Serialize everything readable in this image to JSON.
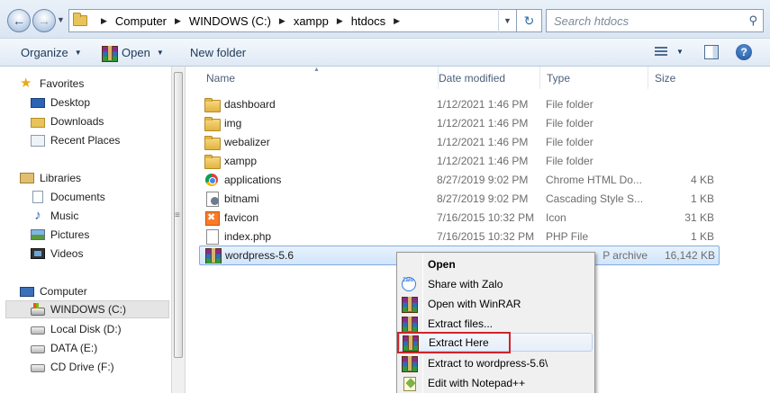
{
  "address": {
    "crumbs": [
      "Computer",
      "WINDOWS (C:)",
      "xampp",
      "htdocs"
    ],
    "search_placeholder": "Search htdocs"
  },
  "toolbar": {
    "organize": "Organize",
    "open": "Open",
    "new_folder": "New folder"
  },
  "nav": {
    "favorites": "Favorites",
    "favorites_items": [
      "Desktop",
      "Downloads",
      "Recent Places"
    ],
    "libraries": "Libraries",
    "library_items": [
      "Documents",
      "Music",
      "Pictures",
      "Videos"
    ],
    "computer": "Computer",
    "computer_items": [
      "WINDOWS (C:)",
      "Local Disk (D:)",
      "DATA (E:)",
      "CD Drive (F:)"
    ],
    "selected": "WINDOWS (C:)"
  },
  "columns": {
    "name": "Name",
    "date": "Date modified",
    "type": "Type",
    "size": "Size"
  },
  "files": [
    {
      "name": "dashboard",
      "date": "1/12/2021 1:46 PM",
      "type": "File folder",
      "size": "",
      "icon": "folder-icon"
    },
    {
      "name": "img",
      "date": "1/12/2021 1:46 PM",
      "type": "File folder",
      "size": "",
      "icon": "folder-icon"
    },
    {
      "name": "webalizer",
      "date": "1/12/2021 1:46 PM",
      "type": "File folder",
      "size": "",
      "icon": "folder-icon"
    },
    {
      "name": "xampp",
      "date": "1/12/2021 1:46 PM",
      "type": "File folder",
      "size": "",
      "icon": "folder-icon"
    },
    {
      "name": "applications",
      "date": "8/27/2019 9:02 PM",
      "type": "Chrome HTML Do...",
      "size": "4 KB",
      "icon": "chrome-icon"
    },
    {
      "name": "bitnami",
      "date": "8/27/2019 9:02 PM",
      "type": "Cascading Style S...",
      "size": "1 KB",
      "icon": "css-file-icon"
    },
    {
      "name": "favicon",
      "date": "7/16/2015 10:32 PM",
      "type": "Icon",
      "size": "31 KB",
      "icon": "ico-file-icon"
    },
    {
      "name": "index.php",
      "date": "7/16/2015 10:32 PM",
      "type": "PHP File",
      "size": "1 KB",
      "icon": "php-file-icon"
    },
    {
      "name": "wordpress-5.6",
      "date": "",
      "type": "P archive",
      "size": "16,142 KB",
      "icon": "winrar-icon"
    }
  ],
  "selected_file": "wordpress-5.6",
  "context_menu": [
    {
      "label": "Open",
      "icon": "",
      "bold": true
    },
    {
      "label": "Share with Zalo",
      "icon": "zalo-icon"
    },
    {
      "label": "Open with WinRAR",
      "icon": "winrar-icon"
    },
    {
      "label": "Extract files...",
      "icon": "winrar-icon"
    },
    {
      "label": "Extract Here",
      "icon": "winrar-icon",
      "highlighted": true
    },
    {
      "label": "Extract to wordpress-5.6\\",
      "icon": "winrar-icon"
    },
    {
      "label": "Edit with Notepad++",
      "icon": "notepad-plus-plus-icon"
    }
  ],
  "zalo_icon_text": "Zalo",
  "highlight_color": "#d0232a"
}
